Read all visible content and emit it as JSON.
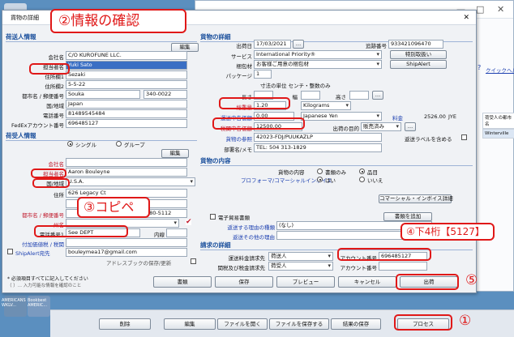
{
  "desktop": {
    "icons": [
      {
        "label": ""
      },
      {
        "label": "AMERICANS WKLV..."
      },
      {
        "label": "Bookbest AMERIC..."
      }
    ]
  },
  "background_window": {
    "help_link": "クイックヘルプ",
    "grid_cells": [
      "荷受人の都市名",
      "Winterville"
    ],
    "window_controls": {
      "minimize": "—",
      "maximize": "□",
      "close": "✕"
    }
  },
  "dialog": {
    "title": "貨物の詳細",
    "close": "✕",
    "sender": {
      "header": "荷送人情報",
      "edit_label": "編集",
      "fields": [
        {
          "label": "会社名",
          "value": "C/O KUROFUNE LLC."
        },
        {
          "label": "担当者名",
          "value": "Yuki Sato"
        },
        {
          "label": "住所欄1",
          "value": "Sezaki"
        },
        {
          "label": "住所欄2",
          "value": "5-5-22"
        },
        {
          "label": "都市名 / 郵便番号",
          "value": "Souka",
          "value2": "340-0022"
        },
        {
          "label": "国/地域",
          "value": "Japan"
        },
        {
          "label": "電話番号",
          "value": "81489545484"
        },
        {
          "label": "FedExアカウント番号",
          "value": "696485127"
        }
      ]
    },
    "recipient": {
      "header": "荷受人情報",
      "radio_single": "シングル",
      "radio_group": "グループ",
      "edit_label": "編集",
      "fields": [
        {
          "label": "会社名",
          "value": ""
        },
        {
          "label": "担当者名",
          "value": "Aaron Bouleyne"
        },
        {
          "label": "国/地域",
          "value": "U.S.A."
        },
        {
          "label": "住所",
          "value": "626 Legacy Ct"
        },
        {
          "label": "都市名 / 郵便番号",
          "value": "",
          "value2": "580-5112"
        },
        {
          "label": "州名",
          "value": ""
        },
        {
          "label": "電話番号1",
          "value": "See DEPT"
        },
        {
          "label": "付加価値税 / 税関",
          "value": ""
        },
        {
          "label": "ShipAlert宛先",
          "value": "bouleymea17@gmail.com"
        }
      ],
      "ext_label": "内線",
      "address_book": "アドレスブックの保存/更新"
    },
    "shipment": {
      "header": "貨物の詳細",
      "ship_date_label": "出荷日",
      "ship_date": "17/03/2021",
      "ref_label": "追跡番号",
      "ref_value": "933421096470",
      "service_label": "サービス",
      "service_value": "International Priority®",
      "special_button": "特別取扱い",
      "packaging_label": "梱包材",
      "packaging_value": "お客様ご用意の梱包材",
      "shipalert_button": "ShipAlert",
      "package_count_label": "パッケージ",
      "package_count": "1",
      "dim_note": "寸法の単位 センチ・整数のみ",
      "length_label": "長さ",
      "width_label": "幅",
      "height_label": "高さ",
      "weight_label": "総重量",
      "weight_value": "1.20",
      "weight_unit": "Kilograms",
      "carriage_label": "運送申告価額",
      "carriage_value": "0.00",
      "currency": "Japanese Yen",
      "fee_label": "料金",
      "fee_value": "2526.00",
      "fee_currency": "JYE",
      "customs_label": "税関申告価額",
      "customs_value": "12500.00",
      "purpose_label": "出荷の目的",
      "purpose_value": "販売済み",
      "harm_label": "貨物の参照",
      "harm_value": "42023-FDJ/PUUKAZLP",
      "return_label": "返送ラベルを含める",
      "dept_label": "部署名/メモ",
      "dept_value": "TEL: 504 313-1829"
    },
    "contents": {
      "header": "貨物の内容",
      "type_label": "貨物の内容",
      "doc_label": "書類のみ",
      "goods_label": "品目",
      "proforma_label": "プロフォーマ/コマーシャルインボイス",
      "yes_label": "はい",
      "no_label": "いいえ",
      "invoice_button": "コマーシャル・インボイス詳細"
    },
    "dangerous": {
      "checkbox_label": "電子貿易書類",
      "add_doc_button": "書類を追加",
      "reason_label": "返送する理由の種類",
      "reason_value": "(なし)",
      "other_label": "返送その他の理由"
    },
    "billing": {
      "header": "請求の詳細",
      "transport_label": "運送料金請求先",
      "transport_value": "荷送人",
      "transport_acct_label": "アカウント番号",
      "transport_acct_value": "696485127",
      "duties_label": "関税及び税金請求先",
      "duties_value": "荷受人",
      "duties_acct_label": "アカウント番号",
      "duties_acct_value": ""
    },
    "footer": {
      "note1": "* 必須項目すべてに記入してください",
      "note2": "（ ）... 入力可能な情報を確認のこと",
      "buttons": [
        "書類",
        "保存",
        "プレビュー",
        "キャンセル",
        "出荷"
      ]
    }
  },
  "bottom_toolbar": {
    "buttons": [
      "削除",
      "編集",
      "ファイルを開く",
      "ファイルを保存する",
      "結果の保存",
      "プロセス"
    ]
  },
  "annotations": {
    "title_callout": "②情報の確認",
    "copy_callout": "③コピペ",
    "last4_callout": "④下4桁【5127】",
    "num5": "⑤",
    "num1": "①"
  }
}
